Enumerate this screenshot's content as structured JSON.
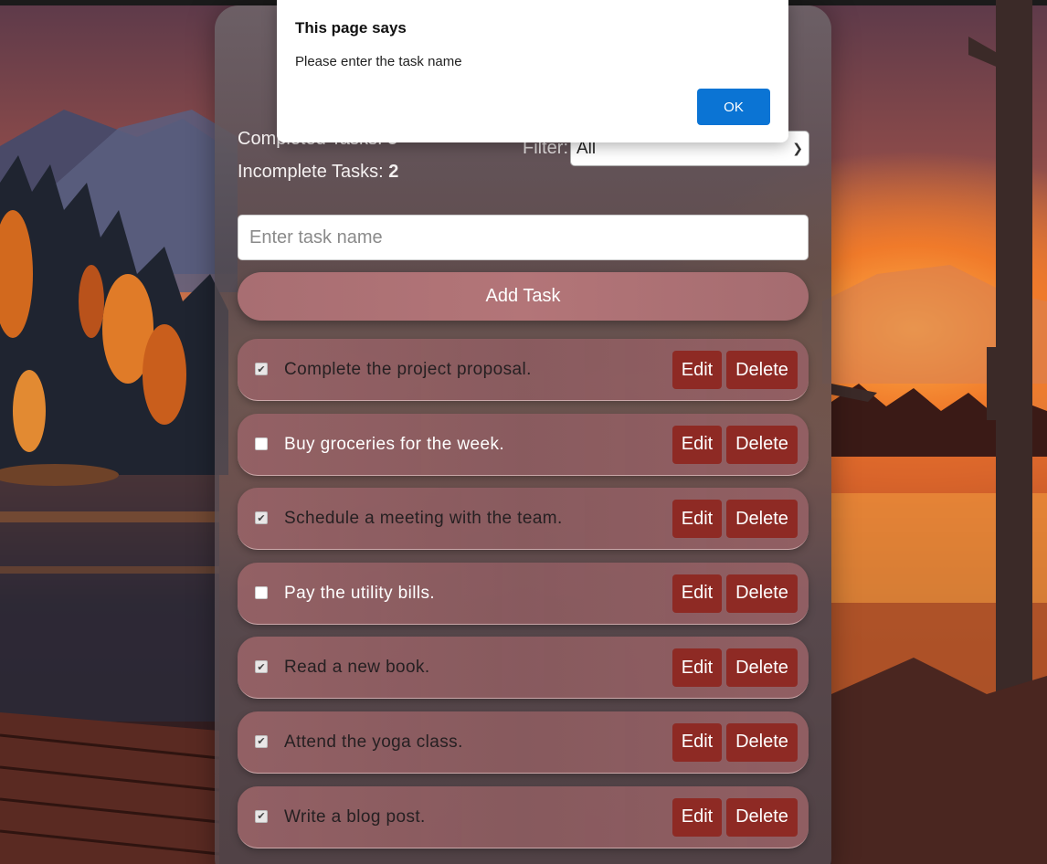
{
  "dialog": {
    "title": "This page says",
    "message": "Please enter the task name",
    "ok_label": "OK"
  },
  "stats": {
    "completed_label": "Completed Tasks:",
    "completed_count": "5",
    "incomplete_label": "Incomplete Tasks:",
    "incomplete_count": "2"
  },
  "filter": {
    "label": "Filter:",
    "selected": "All"
  },
  "input": {
    "placeholder": "Enter task name",
    "value": ""
  },
  "add_button_label": "Add Task",
  "task_buttons": {
    "edit_label": "Edit",
    "delete_label": "Delete"
  },
  "tasks": [
    {
      "name": "Complete the project proposal.",
      "completed": true
    },
    {
      "name": "Buy groceries for the week.",
      "completed": false
    },
    {
      "name": "Schedule a meeting with the team.",
      "completed": true
    },
    {
      "name": "Pay the utility bills.",
      "completed": false
    },
    {
      "name": "Read a new book.",
      "completed": true
    },
    {
      "name": "Attend the yoga class.",
      "completed": true
    },
    {
      "name": "Write a blog post.",
      "completed": true
    }
  ],
  "colors": {
    "button_red": "#8e2a24",
    "add_button": "#b37578",
    "ok_blue": "#0b74d4"
  }
}
